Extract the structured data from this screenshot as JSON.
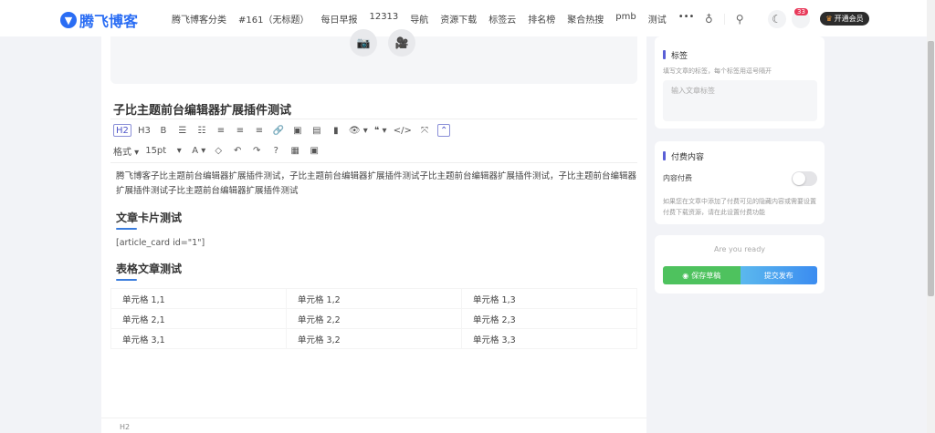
{
  "header": {
    "logo": "腾飞博客",
    "nav": [
      "腾飞博客分类",
      "#161（无标题）",
      "每日早报",
      "12313",
      "导航",
      "资源下载",
      "标签云",
      "排名榜",
      "聚合热搜",
      "pmb",
      "测试",
      "•••"
    ],
    "badge": "33",
    "vip": "开通会员"
  },
  "editor": {
    "title": "子比主题前台编辑器扩展插件测试",
    "toolbar1": [
      "H2",
      "H3",
      "B",
      "☰",
      "☷",
      "≡",
      "≡",
      "≡",
      "🔗",
      "▣",
      "▤",
      "▮",
      "👁 ▾",
      "❝ ▾",
      "</>",
      "⤧",
      "⌃"
    ],
    "toolbar2": [
      "格式 ▾",
      "15pt",
      "▾",
      "A ▾",
      "◇",
      "↶",
      "↷",
      "?",
      "▦",
      "▣"
    ],
    "paragraph": "腾飞博客子比主题前台编辑器扩展插件测试，子比主题前台编辑器扩展插件测试子比主题前台编辑器扩展插件测试，子比主题前台编辑器扩展插件测试子比主题前台编辑器扩展插件测试",
    "h3_1": "文章卡片测试",
    "shortcode": "[article_card id=\"1\"]",
    "h3_2": "表格文章测试",
    "table": [
      [
        "单元格 1,1",
        "单元格 1,2",
        "单元格 1,3"
      ],
      [
        "单元格 2,1",
        "单元格 2,2",
        "单元格 2,3"
      ],
      [
        "单元格 3,1",
        "单元格 3,2",
        "单元格 3,3"
      ]
    ],
    "status": "H2"
  },
  "sidebar": {
    "tags": {
      "title": "标签",
      "hint": "填写文章的标签，每个标签用逗号隔开",
      "placeholder": "输入文章标签"
    },
    "paid": {
      "title": "付费内容",
      "label": "内容付费",
      "enabled": false,
      "hint": "如果您在文章中添加了付费可见的隐藏内容或需要设置付费下载资源，请在此设置付费功能"
    },
    "actions": {
      "ready": "Are you ready",
      "save": "保存草稿",
      "submit": "提交发布"
    }
  }
}
